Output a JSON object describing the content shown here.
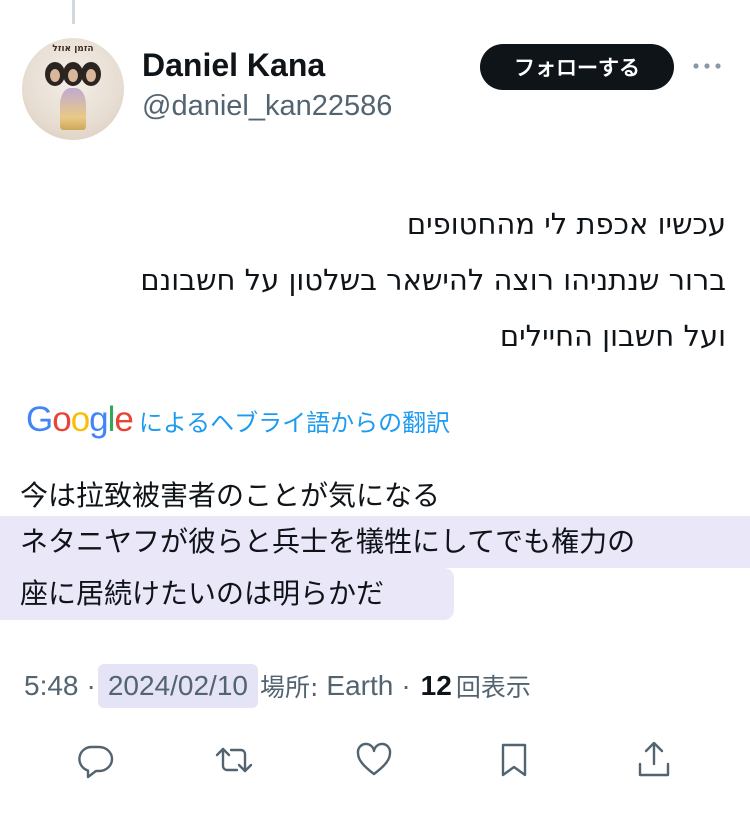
{
  "author": {
    "display_name": "Daniel Kana",
    "handle": "@daniel_kan22586",
    "avatar_caption": "הזמן אוזל",
    "follow_label": "フォローする"
  },
  "tweet": {
    "lines": [
      "עכשיו אכפת לי מהחטופים",
      "ברור שנתניהו רוצה להישאר בשלטון על חשבונם",
      "ועל חשבון החיילים"
    ]
  },
  "translation": {
    "google_letters": [
      "G",
      "o",
      "o",
      "g",
      "l",
      "e"
    ],
    "google_colors": [
      "#4285F4",
      "#EA4335",
      "#FBBC05",
      "#4285F4",
      "#34A853",
      "#EA4335"
    ],
    "label": "によるヘブライ語からの翻訳",
    "lines": [
      "今は拉致被害者のことが気になる",
      "ネタニヤフが彼らと兵士を犠牲にしてでも権力の",
      "座に居続けたいのは明らかだ"
    ],
    "highlight_color": "#e9e7f8"
  },
  "meta": {
    "time": "5:48",
    "separator": "·",
    "date": "2024/02/10",
    "location_label": "場所:",
    "location": "Earth",
    "views_count": "12",
    "views_label": "回表示"
  },
  "actions": {
    "icons": [
      "reply-icon",
      "retweet-icon",
      "like-icon",
      "bookmark-icon",
      "share-icon"
    ],
    "icon_color": "#536471"
  }
}
